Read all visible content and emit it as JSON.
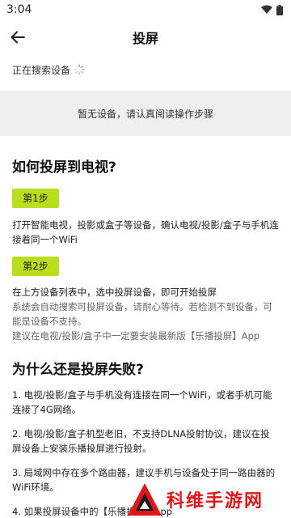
{
  "status": {
    "time": "3:04"
  },
  "header": {
    "title": "投屏",
    "back_icon": "arrow-left-icon"
  },
  "search": {
    "label": "正在搜索设备"
  },
  "empty": {
    "message": "暂无设备，请认真阅读操作步骤"
  },
  "how_to": {
    "title": "如何投屏到电视?",
    "steps": [
      {
        "badge": "第1步",
        "lines": [
          "打开智能电视，投影或盒子等设备，确认电视/投影/盒子与手机连接着同一个WiFi"
        ]
      },
      {
        "badge": "第2步",
        "lines": [
          "在上方设备列表中，选中投屏设备，即可开始投屏"
        ],
        "notes": [
          "系统会自动搜索可投屏设备，请耐心等待。若检测不到设备，可能是设备不支持。",
          "建议在电视/投影/盒子中一定要安装最新版【乐播投屏】App"
        ]
      }
    ]
  },
  "why_fail": {
    "title": "为什么还是投屏失败?",
    "items": [
      "1. 电视/投影/盒子与手机没有连接在同一个WiFi，或者手机可能连接了4G网络。",
      "2. 电视/投影/盒子机型老旧，不支持DLNA投射协议，建议在投屏设备上安装乐播投屏进行投射。",
      "3. 局域网中存在多个路由器，建议手机与设备处于同一路由器的WiFi环境。",
      "4. 如果投屏设备中的【乐播投屏】App为最新版本"
    ]
  },
  "watermark": {
    "text": "科维手游网"
  },
  "colors": {
    "accent": "#b8df1e",
    "watermark_red": "#e0161b"
  }
}
